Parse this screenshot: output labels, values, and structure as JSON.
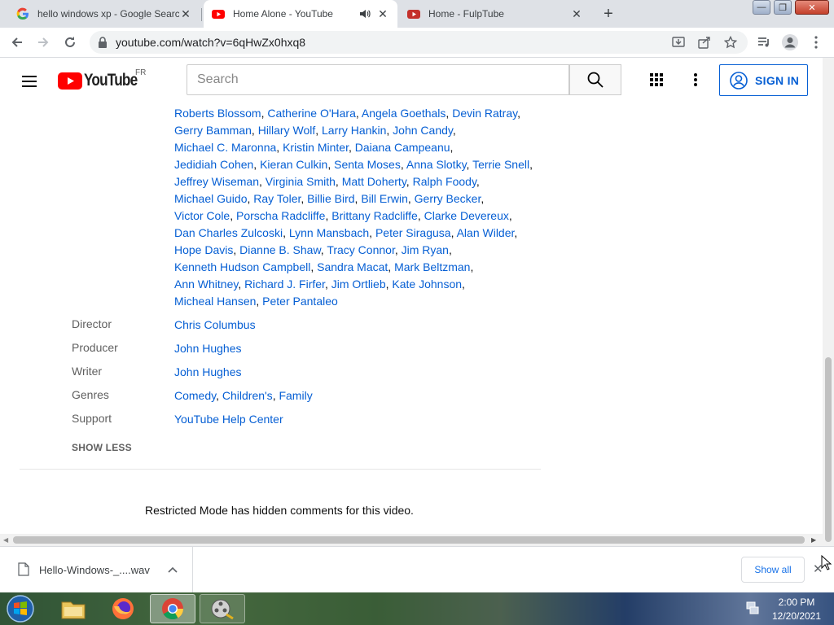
{
  "browser": {
    "tabs": [
      {
        "title": "hello windows xp - Google Search",
        "favicon": "google-g-icon",
        "active": false
      },
      {
        "title": "Home Alone - YouTube",
        "favicon": "youtube-icon",
        "active": true,
        "audio": true
      },
      {
        "title": "Home - FulpTube",
        "favicon": "youtube-icon",
        "active": false
      }
    ],
    "url": "youtube.com/watch?v=6qHwZx0hxq8"
  },
  "youtube": {
    "logo_text": "YouTube",
    "region": "FR",
    "search_placeholder": "Search",
    "signin_label": "SIGN IN"
  },
  "cast_lines": [
    [
      {
        "t": "Roberts Blossom",
        "l": true
      },
      {
        "t": ", "
      },
      {
        "t": "Catherine O'Hara",
        "l": true
      },
      {
        "t": ", "
      },
      {
        "t": "Angela Goethals",
        "l": true
      },
      {
        "t": ", "
      },
      {
        "t": "Devin Ratray",
        "l": true
      },
      {
        "t": ","
      }
    ],
    [
      {
        "t": "Gerry Bamman",
        "l": true
      },
      {
        "t": ", "
      },
      {
        "t": "Hillary Wolf",
        "l": true
      },
      {
        "t": ", "
      },
      {
        "t": "Larry Hankin",
        "l": true
      },
      {
        "t": ", "
      },
      {
        "t": "John Candy",
        "l": true
      },
      {
        "t": ","
      }
    ],
    [
      {
        "t": "Michael C. Maronna",
        "l": true
      },
      {
        "t": ", "
      },
      {
        "t": "Kristin Minter",
        "l": true
      },
      {
        "t": ", "
      },
      {
        "t": "Daiana Campeanu",
        "l": true
      },
      {
        "t": ","
      }
    ],
    [
      {
        "t": "Jedidiah Cohen",
        "l": true
      },
      {
        "t": ", "
      },
      {
        "t": "Kieran Culkin",
        "l": true
      },
      {
        "t": ", "
      },
      {
        "t": "Senta Moses",
        "l": true
      },
      {
        "t": ", "
      },
      {
        "t": "Anna Slotky",
        "l": true
      },
      {
        "t": ", "
      },
      {
        "t": "Terrie Snell",
        "l": true
      },
      {
        "t": ","
      }
    ],
    [
      {
        "t": "Jeffrey Wiseman",
        "l": true
      },
      {
        "t": ", "
      },
      {
        "t": "Virginia Smith",
        "l": true
      },
      {
        "t": ", "
      },
      {
        "t": "Matt Doherty",
        "l": true
      },
      {
        "t": ", "
      },
      {
        "t": "Ralph Foody",
        "l": true
      },
      {
        "t": ","
      }
    ],
    [
      {
        "t": "Michael Guido",
        "l": true
      },
      {
        "t": ", "
      },
      {
        "t": "Ray Toler",
        "l": true
      },
      {
        "t": ", "
      },
      {
        "t": "Billie Bird",
        "l": true
      },
      {
        "t": ", "
      },
      {
        "t": "Bill Erwin",
        "l": true
      },
      {
        "t": ", "
      },
      {
        "t": "Gerry Becker",
        "l": true
      },
      {
        "t": ","
      }
    ],
    [
      {
        "t": "Victor Cole",
        "l": true
      },
      {
        "t": ", "
      },
      {
        "t": "Porscha Radcliffe",
        "l": true
      },
      {
        "t": ", "
      },
      {
        "t": "Brittany Radcliffe",
        "l": true
      },
      {
        "t": ", "
      },
      {
        "t": "Clarke Devereux",
        "l": true
      },
      {
        "t": ","
      }
    ],
    [
      {
        "t": "Dan Charles Zulcoski",
        "l": true
      },
      {
        "t": ", "
      },
      {
        "t": "Lynn Mansbach",
        "l": true
      },
      {
        "t": ", "
      },
      {
        "t": "Peter Siragusa",
        "l": true
      },
      {
        "t": ", "
      },
      {
        "t": "Alan Wilder",
        "l": true
      },
      {
        "t": ","
      }
    ],
    [
      {
        "t": "Hope Davis",
        "l": true
      },
      {
        "t": ", "
      },
      {
        "t": "Dianne B. Shaw",
        "l": true
      },
      {
        "t": ", "
      },
      {
        "t": "Tracy Connor",
        "l": true
      },
      {
        "t": ", "
      },
      {
        "t": "Jim Ryan",
        "l": true
      },
      {
        "t": ","
      }
    ],
    [
      {
        "t": "Kenneth Hudson Campbell",
        "l": true
      },
      {
        "t": ", "
      },
      {
        "t": "Sandra Macat",
        "l": true
      },
      {
        "t": ", "
      },
      {
        "t": "Mark Beltzman",
        "l": true
      },
      {
        "t": ","
      }
    ],
    [
      {
        "t": "Ann Whitney",
        "l": true
      },
      {
        "t": ", "
      },
      {
        "t": "Richard J. Firfer",
        "l": true
      },
      {
        "t": ", "
      },
      {
        "t": "Jim Ortlieb",
        "l": true
      },
      {
        "t": ", "
      },
      {
        "t": "Kate Johnson",
        "l": true
      },
      {
        "t": ","
      }
    ],
    [
      {
        "t": "Micheal Hansen",
        "l": true
      },
      {
        "t": ", "
      },
      {
        "t": "Peter Pantaleo",
        "l": true
      }
    ]
  ],
  "metadata": [
    {
      "label": "Director",
      "value": [
        {
          "t": "Chris Columbus",
          "l": true
        }
      ]
    },
    {
      "label": "Producer",
      "value": [
        {
          "t": "John Hughes",
          "l": true
        }
      ]
    },
    {
      "label": "Writer",
      "value": [
        {
          "t": "John Hughes",
          "l": true
        }
      ]
    },
    {
      "label": "Genres",
      "value": [
        {
          "t": "Comedy",
          "l": true
        },
        {
          "t": ", "
        },
        {
          "t": "Children's",
          "l": true
        },
        {
          "t": ", "
        },
        {
          "t": "Family",
          "l": true
        }
      ]
    },
    {
      "label": "Support",
      "value": [
        {
          "t": "YouTube Help Center",
          "l": true
        }
      ]
    }
  ],
  "show_less_label": "SHOW LESS",
  "restricted_message": "Restricted Mode has hidden comments for this video.",
  "download": {
    "filename": "Hello-Windows-_....wav",
    "show_all_label": "Show all"
  },
  "taskbar": {
    "time": "2:00 PM",
    "date": "12/20/2021"
  },
  "colors": {
    "link": "#065fd4",
    "youtube_red": "#ff0000"
  }
}
